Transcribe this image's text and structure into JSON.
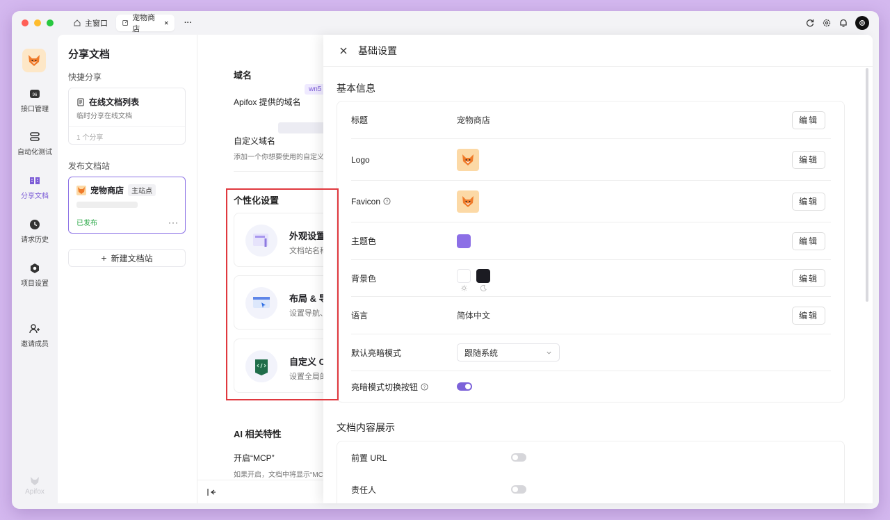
{
  "titlebar": {
    "tabs": [
      {
        "label": "主窗口"
      },
      {
        "label": "宠物商店"
      }
    ],
    "more": "···"
  },
  "leftnav": {
    "items": [
      {
        "label": "接口管理",
        "icon": "api-icon"
      },
      {
        "label": "自动化测试",
        "icon": "stack-icon"
      },
      {
        "label": "分享文档",
        "icon": "book-icon"
      },
      {
        "label": "请求历史",
        "icon": "clock-icon"
      },
      {
        "label": "项目设置",
        "icon": "gear-icon"
      },
      {
        "label": "邀请成员",
        "icon": "user-add-icon"
      }
    ],
    "brand": "Apifox"
  },
  "share_panel": {
    "title": "分享文档",
    "quick_share": "快捷分享",
    "quick_card": {
      "title": "在线文档列表",
      "sub": "临时分享在线文档",
      "count": "1 个分享"
    },
    "publish_label": "发布文档站",
    "site_card": {
      "title": "宠物商店",
      "badge": "主站点",
      "status": "已发布",
      "more": "···"
    },
    "new_site": "新建文档站"
  },
  "main": {
    "domain_title": "域名",
    "apifox_domain": "Apifox 提供的域名",
    "domain_tag": "wn5",
    "custom_domain": "自定义域名",
    "custom_domain_hint": "添加一个你想要使用的自定义",
    "personal_title": "个性化设置",
    "features": [
      {
        "title": "外观设置",
        "sub": "文档站名称"
      },
      {
        "title": "布局 & 导",
        "sub": "设置导航、"
      },
      {
        "title": "自定义 C",
        "sub": "设置全局的"
      }
    ],
    "ai_title": "AI 相关特性",
    "mcp": "开启“MCP”",
    "mcp_hint": "如果开启，文档中将显示“MC"
  },
  "drawer": {
    "title": "基础设置",
    "basic_info": "基本信息",
    "rows": {
      "title": {
        "label": "标题",
        "value": "宠物商店"
      },
      "logo": {
        "label": "Logo"
      },
      "favicon": {
        "label": "Favicon"
      },
      "theme": {
        "label": "主题色",
        "color": "#8c6fe6"
      },
      "bg": {
        "label": "背景色",
        "light": "#ffffff",
        "dark": "#1b1b22"
      },
      "lang": {
        "label": "语言",
        "value": "简体中文"
      },
      "mode": {
        "label": "默认亮暗模式",
        "value": "跟随系统"
      },
      "switch": {
        "label": "亮暗模式切换按钮",
        "on": true
      }
    },
    "edit": "编辑",
    "content_title": "文档内容展示",
    "content_rows": [
      {
        "label": "前置 URL",
        "on": false
      },
      {
        "label": "责任人",
        "on": false
      }
    ]
  }
}
